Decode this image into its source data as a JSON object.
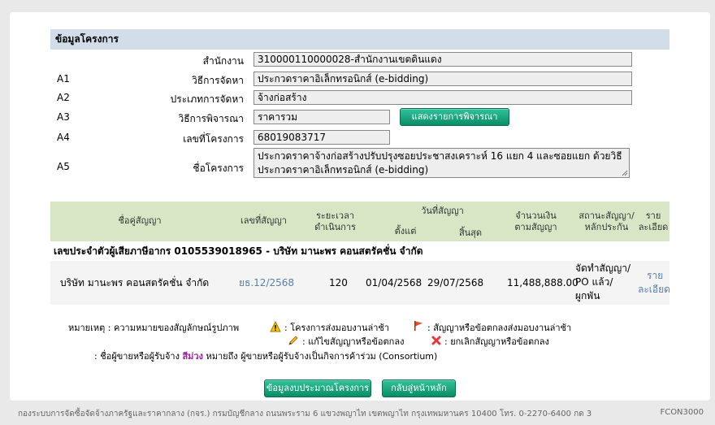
{
  "section_title": "ข้อมูลโครงการ",
  "fields": {
    "office": {
      "label": "สำนักงาน",
      "value": "310000110000028-สำนักงานเขตดินแดง"
    },
    "method": {
      "code": "A1",
      "label": "วิธีการจัดหา",
      "value": "ประกวดราคาอิเล็กทรอนิกส์ (e-bidding)"
    },
    "type": {
      "code": "A2",
      "label": "ประเภทการจัดหา",
      "value": "จ้างก่อสร้าง"
    },
    "consider": {
      "code": "A3",
      "label": "วิธีการพิจารณา",
      "value": "ราคารวม",
      "button": "แสดงรายการพิจารณา"
    },
    "project_no": {
      "code": "A4",
      "label": "เลขที่โครงการ",
      "value": "68019083717"
    },
    "project_name": {
      "code": "A5",
      "label": "ชื่อโครงการ",
      "value": "ประกวดราคาจ้างก่อสร้างปรับปรุงซอยประชาสงเคราะห์ 16 แยก 4 และซอยแยก ด้วยวิธีประกวดราคาอิเล็กทรอนิกส์ (e-bidding)"
    }
  },
  "table": {
    "headers": {
      "contractor": "ชื่อคู่สัญญา",
      "contract_no": "เลขที่สัญญา",
      "duration_1": "ระยะเวลา",
      "duration_2": "ดำเนินการ",
      "date_group": "วันที่สัญญา",
      "start": "ตั้งแต่",
      "end": "สิ้นสุด",
      "amount_1": "จำนวนเงิน",
      "amount_2": "ตามสัญญา",
      "status_1": "สถานะสัญญา/",
      "status_2": "หลักประกัน",
      "detail_1": "ราย",
      "detail_2": "ละเอียด"
    },
    "group_label": "เลขประจำตัวผู้เสียภาษีอากร 0105539018965 - บริษัท มานะพร คอนสตรัคชั่น จำกัด",
    "row": {
      "contractor": "บริษัท มานะพร คอนสตรัคชั่น จำกัด",
      "contract_no": "ยธ.12/2568",
      "duration": "120",
      "start": "01/04/2568",
      "end": "29/07/2568",
      "amount": "11,488,888.00",
      "status_1": "จัดทำสัญญา/",
      "status_2": "PO แล้ว/",
      "status_3": "ผูกพัน",
      "detail_1": "ราย",
      "detail_2": "ละเอียด"
    }
  },
  "notes": {
    "legend": "หมายเหตุ : ความหมายของสัญลักษณ์รูปภาพ",
    "warning": ": โครงการส่งมอบงานล่าช้า",
    "flag": ": สัญญาหรือข้อตกลงส่งมอบงานล่าช้า",
    "edit": ": แก้ไขสัญญาหรือข้อตกลง",
    "cancel": ": ยกเลิกสัญญาหรือข้อตกลง",
    "consortium_prefix": ": ชื่อผู้ขายหรือผู้รับจ้าง",
    "consortium_color_word": "สีม่วง",
    "consortium_suffix": "หมายถึง ผู้ขายหรือผู้รับจ้างเป็นกิจการค้าร่วม (Consortium)"
  },
  "buttons": {
    "budget": "ข้อมูลงบประมาณโครงการ",
    "back": "กลับสู่หน้าหลัก"
  },
  "footer": {
    "text": "กองระบบการจัดซื้อจัดจ้างภาครัฐและราคากลาง (กจร.) กรมบัญชีกลาง ถนนพระราม 6 แขวงพญาไท เขตพญาไท กรุงเทพมหานคร 10400 โทร. 0-2270-6400 กด 3",
    "code": "FCON3000"
  },
  "colors": {
    "section_bg": "#d3dde9",
    "table_head_bg": "#d8e6c6",
    "button": "#16a87d",
    "link": "#5b7fa6",
    "consortium_purple": "#a020a0"
  }
}
